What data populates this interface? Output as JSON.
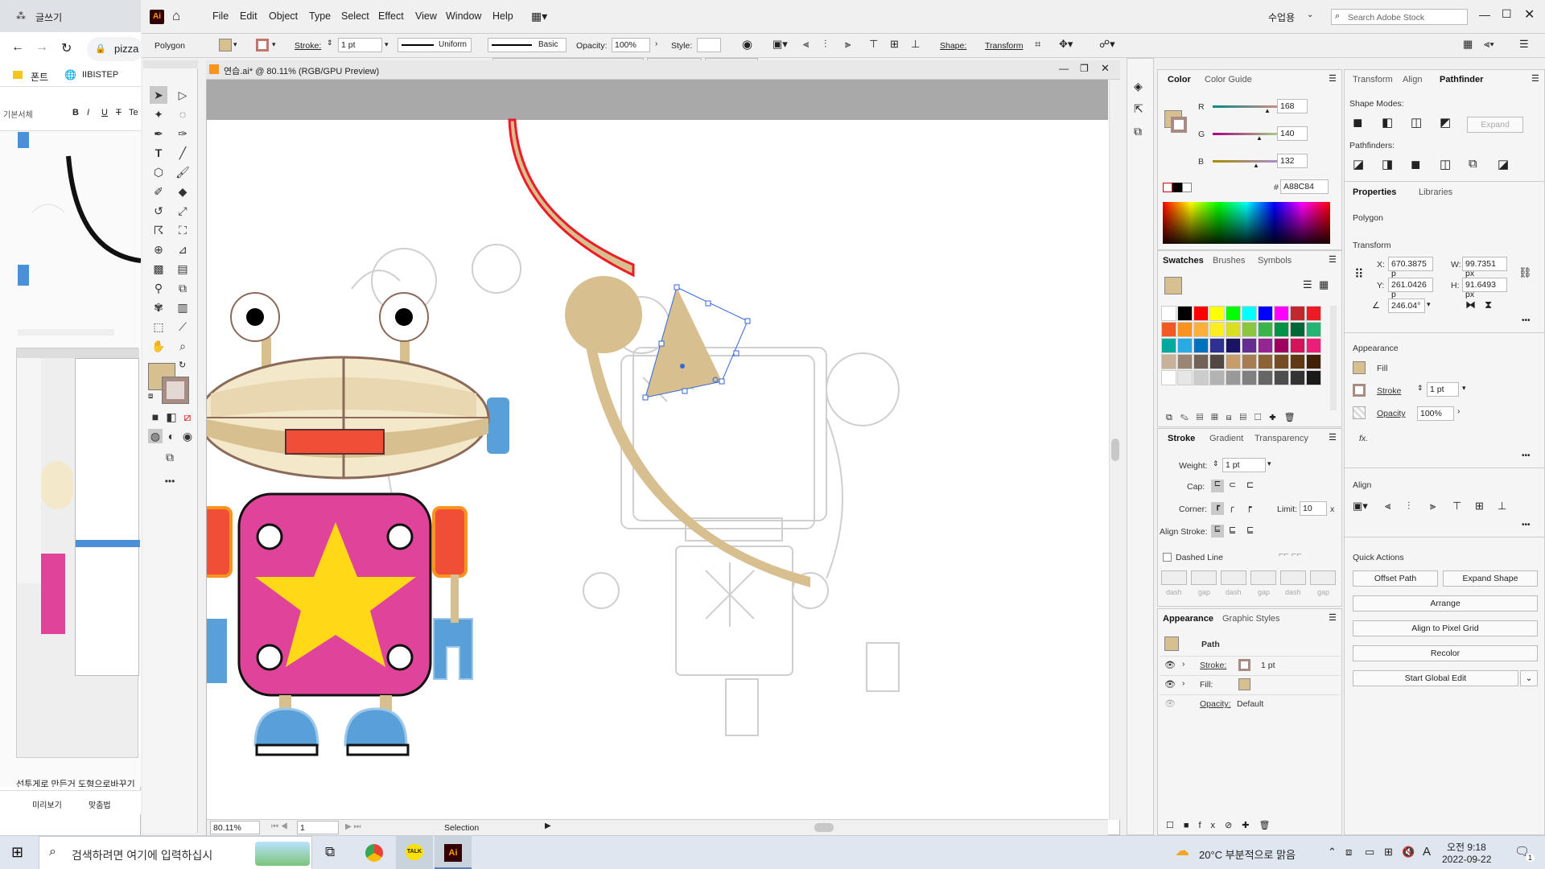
{
  "browser": {
    "tab_title": "글쓰기",
    "address": "pizza",
    "bookmarks": [
      "폰트",
      "IIBISTEP"
    ],
    "editor_toolbar": [
      "기본서체",
      "B",
      "I",
      "U",
      "T",
      "Te"
    ],
    "caption": "선투게로 만든거 도형으로바꾸기",
    "footer_buttons": [
      "미리보기",
      "맞춤법"
    ]
  },
  "app": {
    "menus": [
      "File",
      "Edit",
      "Object",
      "Type",
      "Select",
      "Effect",
      "View",
      "Window",
      "Help"
    ],
    "workspace": "수업용",
    "search_placeholder": "Search Adobe Stock"
  },
  "control_bar": {
    "object_type": "Polygon",
    "stroke_label": "Stroke:",
    "stroke_value": "1 pt",
    "profile": "Uniform",
    "brush": "Basic",
    "opacity_label": "Opacity:",
    "opacity_value": "100%",
    "style_label": "Style:",
    "shape_label": "Shape:",
    "transform_label": "Transform"
  },
  "document": {
    "tab_title": "연습.ai* @ 80.11% (RGB/GPU Preview)",
    "zoom": "80.11%",
    "artboard": "1",
    "status_tool": "Selection"
  },
  "color_panel": {
    "tabs": [
      "Color",
      "Color Guide"
    ],
    "r_label": "R",
    "r": "168",
    "g_label": "G",
    "g": "140",
    "b_label": "B",
    "b": "132",
    "hex_label": "#",
    "hex": "A88C84"
  },
  "swatches_panel": {
    "tabs": [
      "Swatches",
      "Brushes",
      "Symbols"
    ],
    "colors": [
      "#ffffff",
      "#000000",
      "#ff0000",
      "#ffff00",
      "#00ff00",
      "#00ffff",
      "#0000ff",
      "#ff00ff",
      "#c1272d",
      "#ed1c24",
      "#f15a24",
      "#f7931e",
      "#fbb03b",
      "#fcee21",
      "#d9e021",
      "#8cc63f",
      "#39b54a",
      "#009245",
      "#006837",
      "#22b573",
      "#00a99d",
      "#29abe2",
      "#0071bc",
      "#2e3192",
      "#1b1464",
      "#662d91",
      "#93278f",
      "#9e005d",
      "#d4145a",
      "#ed1e79",
      "#c7b299",
      "#998675",
      "#736357",
      "#534741",
      "#c69c6d",
      "#a67c52",
      "#8c6239",
      "#754c24",
      "#603813",
      "#42210b",
      "#ffffff",
      "#e6e6e6",
      "#cccccc",
      "#b3b3b3",
      "#999999",
      "#808080",
      "#666666",
      "#4d4d4d",
      "#333333",
      "#1a1a1a"
    ]
  },
  "stroke_panel": {
    "tabs": [
      "Stroke",
      "Gradient",
      "Transparency"
    ],
    "weight_label": "Weight:",
    "weight_value": "1 pt",
    "cap_label": "Cap:",
    "corner_label": "Corner:",
    "limit_label": "Limit:",
    "limit_value": "10",
    "limit_unit": "x",
    "align_label": "Align Stroke:",
    "dashed_label": "Dashed Line",
    "dash_labels": [
      "dash",
      "gap",
      "dash",
      "gap",
      "dash",
      "gap"
    ]
  },
  "appearance_panel": {
    "tabs": [
      "Appearance",
      "Graphic Styles"
    ],
    "object": "Path",
    "stroke_label": "Stroke:",
    "stroke_value": "1 pt",
    "fill_label": "Fill:",
    "opacity_label": "Opacity:",
    "opacity_value": "Default"
  },
  "right_panel": {
    "tabs_top": [
      "Transform",
      "Align",
      "Pathfinder"
    ],
    "shape_modes_label": "Shape Modes:",
    "expand_label": "Expand",
    "pathfinders_label": "Pathfinders:",
    "tabs_props": [
      "Properties",
      "Libraries"
    ],
    "object_type": "Polygon",
    "transform_label": "Transform",
    "x_label": "X:",
    "x": "670.3875 p",
    "y_label": "Y:",
    "y": "261.0426 p",
    "w_label": "W:",
    "w": "99.7351 px",
    "h_label": "H:",
    "h": "91.6493 px",
    "angle": "246.04°",
    "appearance_label": "Appearance",
    "fill_label": "Fill",
    "stroke_label": "Stroke",
    "stroke_value": "1 pt",
    "opacity_label": "Opacity",
    "opacity_value": "100%",
    "fx_label": "fx.",
    "align_label": "Align",
    "quick_actions_label": "Quick Actions",
    "buttons": [
      "Offset Path",
      "Expand Shape",
      "Arrange",
      "Align to Pixel Grid",
      "Recolor",
      "Start Global Edit"
    ]
  },
  "taskbar": {
    "search_placeholder": "검색하려면 여기에 입력하십시",
    "weather": "20°C 부분적으로 맑음",
    "ime": "A",
    "time": "오전 9:18",
    "date": "2022-09-22",
    "notif_count": "1"
  }
}
